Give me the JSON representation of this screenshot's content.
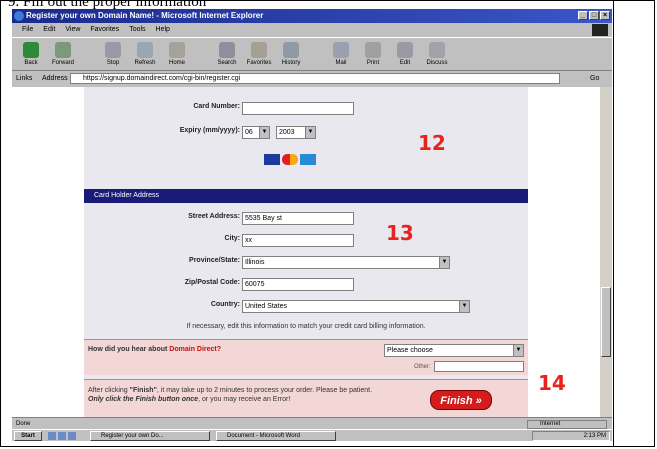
{
  "caption": "9. Fill out the proper information",
  "browser": {
    "title": "Register your own Domain Name! - Microsoft Internet Explorer",
    "menu": [
      "File",
      "Edit",
      "View",
      "Favorites",
      "Tools",
      "Help"
    ],
    "toolbar": [
      {
        "label": "Back",
        "icon": "back-arrow-icon"
      },
      {
        "label": "Forward",
        "icon": "forward-arrow-icon"
      },
      {
        "label": "Stop",
        "icon": "stop-icon"
      },
      {
        "label": "Refresh",
        "icon": "refresh-icon"
      },
      {
        "label": "Home",
        "icon": "home-icon"
      },
      {
        "label": "Search",
        "icon": "search-icon"
      },
      {
        "label": "Favorites",
        "icon": "favorites-icon"
      },
      {
        "label": "History",
        "icon": "history-icon"
      },
      {
        "label": "Mail",
        "icon": "mail-icon"
      },
      {
        "label": "Print",
        "icon": "print-icon"
      },
      {
        "label": "Edit",
        "icon": "edit-icon"
      },
      {
        "label": "Discuss",
        "icon": "discuss-icon"
      }
    ],
    "links_label": "Links",
    "address_label": "Address",
    "address_value": "https://signup.domaindirect.com/cgi-bin/register.cgi",
    "go_label": "Go",
    "status_zone": "Done",
    "status_internet": "Internet"
  },
  "form": {
    "card_number_label": "Card Number:",
    "card_number_value": "",
    "expiry_label": "Expiry (mm/yyyy):",
    "expiry_month": "06",
    "expiry_year": "2003",
    "section_header": "Card Holder Address",
    "street_label": "Street Address:",
    "street_value": "5535 Bay st",
    "city_label": "City:",
    "city_value": "xx",
    "province_label": "Province/State:",
    "province_value": "Illinois",
    "zip_label": "Zip/Postal Code:",
    "zip_value": "60075",
    "country_label": "Country:",
    "country_value": "United States",
    "note": "If necessary, edit this information to match your credit card billing information.",
    "hear_question": "How did you hear about",
    "hear_brand": "Domain Direct?",
    "hear_select": "Please choose",
    "other_label": "Other:",
    "finish_text_1": "After clicking",
    "finish_text_bold": "\"Finish\"",
    "finish_text_2": ", it may take up to 2 minutes to process your order. Please be patient.",
    "finish_text_em": "Only click the Finish button once",
    "finish_text_3": ", or you may receive an Error!",
    "finish_button": "Finish »"
  },
  "steps": [
    "12",
    "13",
    "14"
  ],
  "taskbar": {
    "start": "Start",
    "task1": "Register your own Do...",
    "task2": "Document - Microsoft Word",
    "clock": "2:13 PM"
  }
}
